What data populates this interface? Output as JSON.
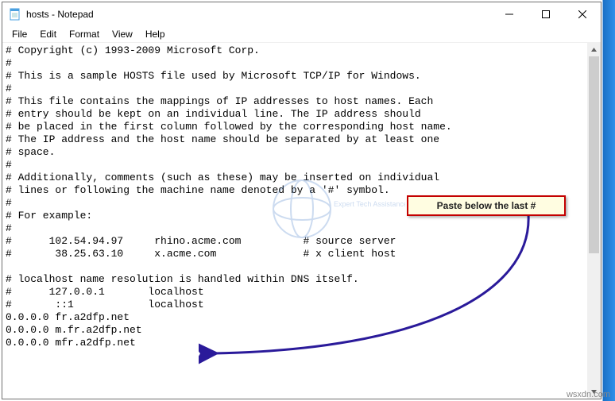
{
  "window": {
    "title": "hosts - Notepad"
  },
  "menu": {
    "file": "File",
    "edit": "Edit",
    "format": "Format",
    "view": "View",
    "help": "Help"
  },
  "editor": {
    "content": "# Copyright (c) 1993-2009 Microsoft Corp.\n#\n# This is a sample HOSTS file used by Microsoft TCP/IP for Windows.\n#\n# This file contains the mappings of IP addresses to host names. Each\n# entry should be kept on an individual line. The IP address should\n# be placed in the first column followed by the corresponding host name.\n# The IP address and the host name should be separated by at least one\n# space.\n#\n# Additionally, comments (such as these) may be inserted on individual\n# lines or following the machine name denoted by a '#' symbol.\n#\n# For example:\n#\n#      102.54.94.97     rhino.acme.com          # source server\n#       38.25.63.10     x.acme.com              # x client host\n\n# localhost name resolution is handled within DNS itself.\n#      127.0.0.1       localhost\n#       ::1            localhost\n0.0.0.0 fr.a2dfp.net\n0.0.0.0 m.fr.a2dfp.net\n0.0.0.0 mfr.a2dfp.net"
  },
  "callout": {
    "text": "Paste below the last #"
  },
  "watermarks": {
    "logo_text": "Expert Tech Assistance",
    "site": "wsxdn.com"
  }
}
